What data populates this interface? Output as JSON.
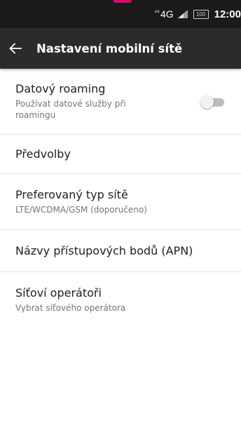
{
  "status_bar": {
    "network_badge": "⁴⁶",
    "network_type": "4G",
    "battery_label": "100",
    "time": "12:00",
    "signal_icon": "signal-icon",
    "battery_icon": "battery-icon"
  },
  "app_bar": {
    "back_icon": "arrow-back-icon",
    "title": "Nastavení mobilní sítě"
  },
  "settings": {
    "data_roaming": {
      "title": "Datový roaming",
      "summary": "Používat datové služby při roamingu",
      "enabled": false
    },
    "preferences": {
      "title": "Předvolby"
    },
    "preferred_network_type": {
      "title": "Preferovaný typ sítě",
      "summary": "LTE/WCDMA/GSM (doporučeno)"
    },
    "apn": {
      "title": "Názvy přístupových bodů (APN)"
    },
    "network_operators": {
      "title": "Síťoví operátoři",
      "summary": "Vybrat síťového operátora"
    }
  },
  "colors": {
    "status_bar": "#1b1b1b",
    "app_bar": "#2b2b2b",
    "accent": "#e20074",
    "divider": "#e4e4e4",
    "primary_text": "#212121",
    "secondary_text": "#757575"
  }
}
